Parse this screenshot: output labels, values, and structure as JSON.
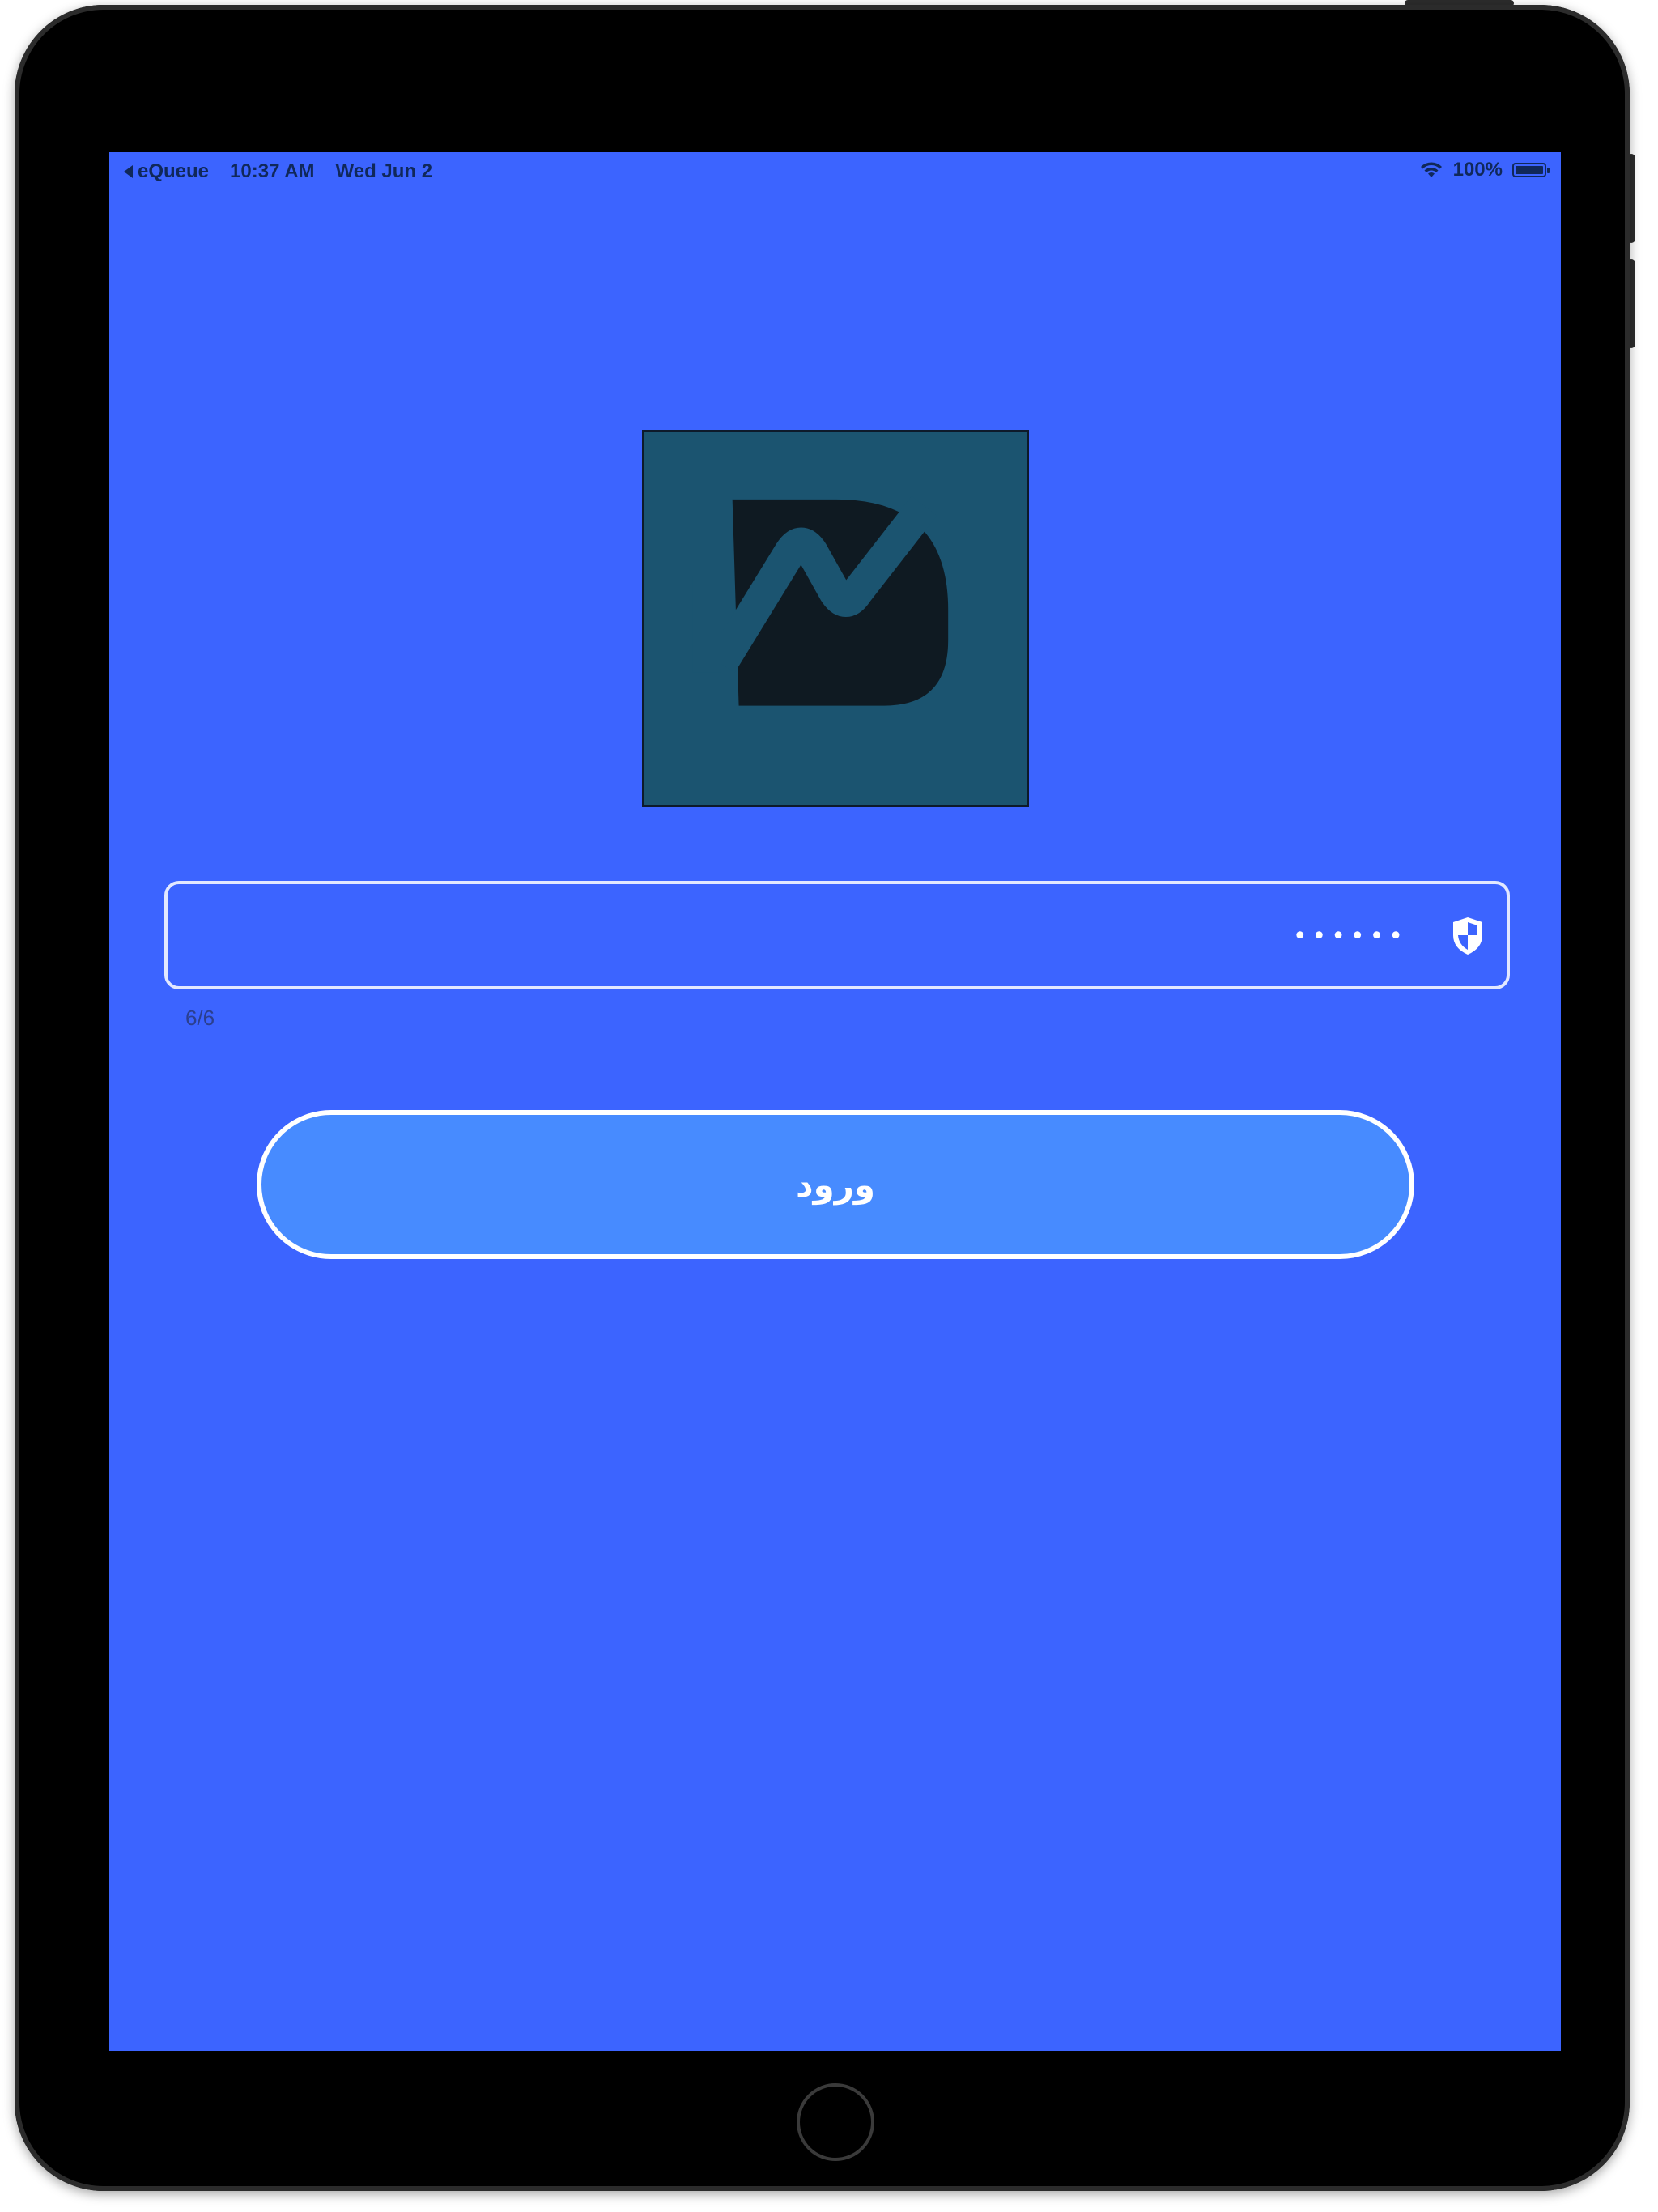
{
  "status_bar": {
    "back_app": "eQueue",
    "time": "10:37 AM",
    "date": "Wed Jun 2",
    "battery": "100%",
    "battery_level": 1.0,
    "wifi_icon": "wifi-icon"
  },
  "logo": {
    "icon": "app-logo-d-wave"
  },
  "password_field": {
    "value": "••••••",
    "icon": "shield-icon",
    "counter": "6/6"
  },
  "login_button": {
    "label": "ورود"
  },
  "colors": {
    "screen_background": "#3c64ff",
    "button_fill": "#478bff",
    "logo_background": "#1b5470",
    "logo_mark": "#0f1a22",
    "device_frame": "#000000"
  }
}
